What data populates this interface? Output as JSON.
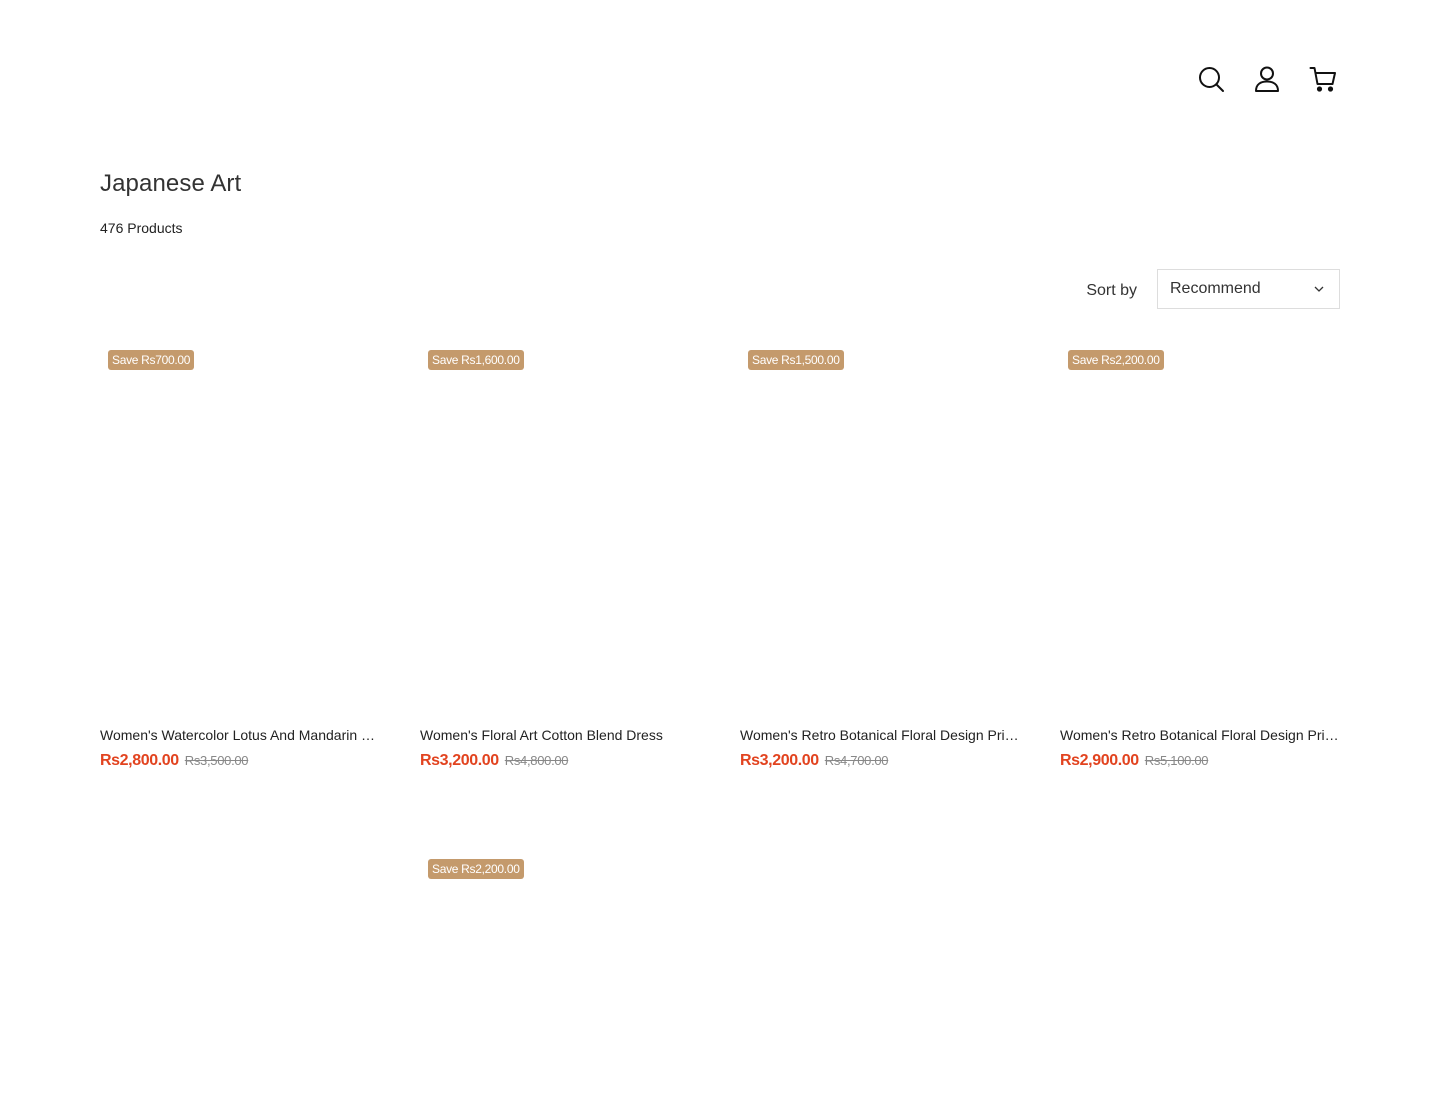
{
  "header": {
    "icons": [
      "search-icon",
      "account-icon",
      "cart-icon"
    ]
  },
  "collection": {
    "title": "Japanese Art",
    "count_label": "476 Products"
  },
  "sort": {
    "label": "Sort by",
    "selected": "Recommend"
  },
  "colors": {
    "badge": "#c49a6c",
    "sale_price": "#e2431f",
    "compare_price": "#888888"
  },
  "products": [
    {
      "badge": "Save Rs700.00",
      "title": "Women's Watercolor Lotus And Mandarin Duck Print Dress",
      "price": "Rs2,800.00",
      "compare_price": "Rs3,500.00"
    },
    {
      "badge": "Save Rs1,600.00",
      "title": "Women's Floral Art Cotton Blend Dress",
      "price": "Rs3,200.00",
      "compare_price": "Rs4,800.00"
    },
    {
      "badge": "Save Rs1,500.00",
      "title": "Women's Retro Botanical Floral Design Print Dress",
      "price": "Rs3,200.00",
      "compare_price": "Rs4,700.00"
    },
    {
      "badge": "Save Rs2,200.00",
      "title": "Women's Retro Botanical Floral Design Print Dress",
      "price": "Rs2,900.00",
      "compare_price": "Rs5,100.00"
    },
    {
      "badge": "",
      "title": "",
      "price": "",
      "compare_price": ""
    },
    {
      "badge": "Save Rs2,200.00",
      "title": "",
      "price": "",
      "compare_price": ""
    }
  ]
}
